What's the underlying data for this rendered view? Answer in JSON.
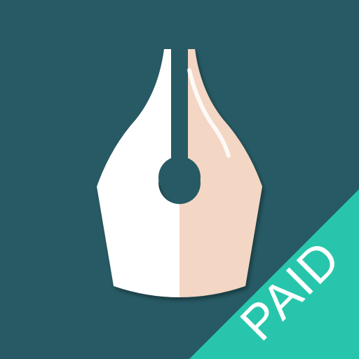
{
  "icon": {
    "name": "fountain-pen-nib-icon",
    "badge_label": "PAID"
  },
  "colors": {
    "background": "#275A64",
    "nib_left": "#FFFFFF",
    "nib_right": "#F3D6C3",
    "nib_highlight": "#FFFFFF",
    "badge": "#27C6AC",
    "badge_text": "#FFFFFF",
    "shadow": "#1C4850"
  }
}
